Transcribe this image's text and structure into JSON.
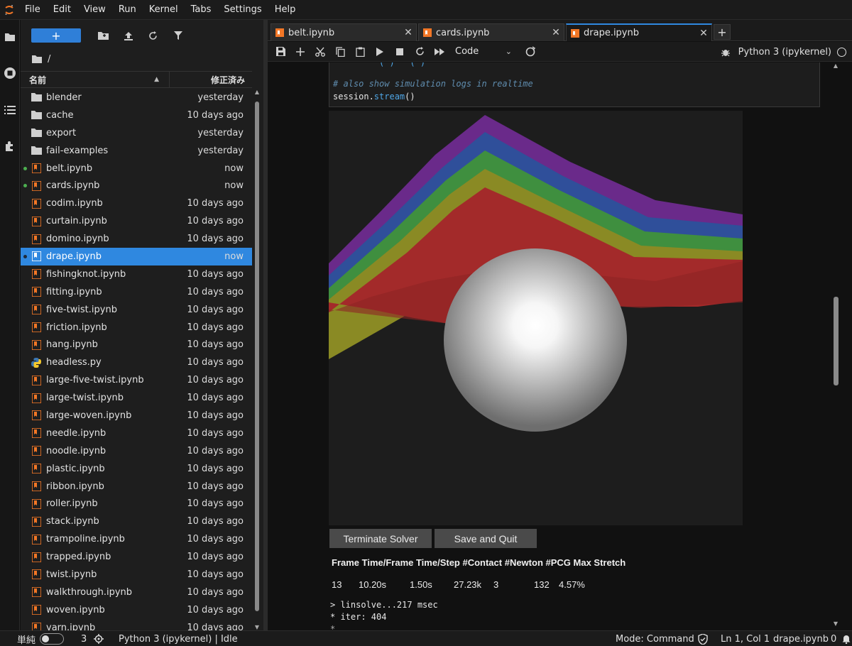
{
  "menubar": {
    "items": [
      "File",
      "Edit",
      "View",
      "Run",
      "Kernel",
      "Tabs",
      "Settings",
      "Help"
    ]
  },
  "filebrowser": {
    "new_label": "+",
    "path": "/",
    "header_name": "名前",
    "header_modified": "修正済み",
    "files": [
      {
        "name": "blender",
        "modified": "yesterday",
        "type": "folder",
        "dot": ""
      },
      {
        "name": "cache",
        "modified": "10 days ago",
        "type": "folder",
        "dot": ""
      },
      {
        "name": "export",
        "modified": "yesterday",
        "type": "folder",
        "dot": ""
      },
      {
        "name": "fail-examples",
        "modified": "yesterday",
        "type": "folder",
        "dot": ""
      },
      {
        "name": "belt.ipynb",
        "modified": "now",
        "type": "notebook",
        "dot": "green"
      },
      {
        "name": "cards.ipynb",
        "modified": "now",
        "type": "notebook",
        "dot": "green"
      },
      {
        "name": "codim.ipynb",
        "modified": "10 days ago",
        "type": "notebook",
        "dot": ""
      },
      {
        "name": "curtain.ipynb",
        "modified": "10 days ago",
        "type": "notebook",
        "dot": ""
      },
      {
        "name": "domino.ipynb",
        "modified": "10 days ago",
        "type": "notebook",
        "dot": ""
      },
      {
        "name": "drape.ipynb",
        "modified": "now",
        "type": "notebook",
        "dot": "dark",
        "selected": true
      },
      {
        "name": "fishingknot.ipynb",
        "modified": "10 days ago",
        "type": "notebook",
        "dot": ""
      },
      {
        "name": "fitting.ipynb",
        "modified": "10 days ago",
        "type": "notebook",
        "dot": ""
      },
      {
        "name": "five-twist.ipynb",
        "modified": "10 days ago",
        "type": "notebook",
        "dot": ""
      },
      {
        "name": "friction.ipynb",
        "modified": "10 days ago",
        "type": "notebook",
        "dot": ""
      },
      {
        "name": "hang.ipynb",
        "modified": "10 days ago",
        "type": "notebook",
        "dot": ""
      },
      {
        "name": "headless.py",
        "modified": "10 days ago",
        "type": "python",
        "dot": ""
      },
      {
        "name": "large-five-twist.ipynb",
        "modified": "10 days ago",
        "type": "notebook",
        "dot": ""
      },
      {
        "name": "large-twist.ipynb",
        "modified": "10 days ago",
        "type": "notebook",
        "dot": ""
      },
      {
        "name": "large-woven.ipynb",
        "modified": "10 days ago",
        "type": "notebook",
        "dot": ""
      },
      {
        "name": "needle.ipynb",
        "modified": "10 days ago",
        "type": "notebook",
        "dot": ""
      },
      {
        "name": "noodle.ipynb",
        "modified": "10 days ago",
        "type": "notebook",
        "dot": ""
      },
      {
        "name": "plastic.ipynb",
        "modified": "10 days ago",
        "type": "notebook",
        "dot": ""
      },
      {
        "name": "ribbon.ipynb",
        "modified": "10 days ago",
        "type": "notebook",
        "dot": ""
      },
      {
        "name": "roller.ipynb",
        "modified": "10 days ago",
        "type": "notebook",
        "dot": ""
      },
      {
        "name": "stack.ipynb",
        "modified": "10 days ago",
        "type": "notebook",
        "dot": ""
      },
      {
        "name": "trampoline.ipynb",
        "modified": "10 days ago",
        "type": "notebook",
        "dot": ""
      },
      {
        "name": "trapped.ipynb",
        "modified": "10 days ago",
        "type": "notebook",
        "dot": ""
      },
      {
        "name": "twist.ipynb",
        "modified": "10 days ago",
        "type": "notebook",
        "dot": ""
      },
      {
        "name": "walkthrough.ipynb",
        "modified": "10 days ago",
        "type": "notebook",
        "dot": ""
      },
      {
        "name": "woven.ipynb",
        "modified": "10 days ago",
        "type": "notebook",
        "dot": ""
      },
      {
        "name": "yarn.ipynb",
        "modified": "10 days ago",
        "type": "notebook",
        "dot": ""
      }
    ]
  },
  "tabs": [
    {
      "label": "belt.ipynb",
      "active": false
    },
    {
      "label": "cards.ipynb",
      "active": false
    },
    {
      "label": "drape.ipynb",
      "active": true
    }
  ],
  "toolbar": {
    "cell_type": "Code",
    "kernel_name": "Python 3 (ipykernel)"
  },
  "cell": {
    "comment": "# also show simulation logs in realtime",
    "code_obj": "session.",
    "code_fn": "stream",
    "code_end": "()"
  },
  "widget": {
    "terminate_label": "Terminate Solver",
    "save_label": "Save and Quit",
    "stats_header": "Frame Time/Frame Time/Step #Contact #Newton #PCG Max Stretch",
    "stats_values": [
      "13",
      "10.20s",
      "1.50s",
      "27.23k",
      "3",
      "132",
      "4.57%"
    ],
    "logs": [
      "> linsolve...217 msec",
      "* iter: 404"
    ]
  },
  "statusbar": {
    "simple_label": "単純",
    "terminal_count": "3",
    "kernel_status": "Python 3 (ipykernel) | Idle",
    "mode": "Mode: Command",
    "cursor": "Ln 1, Col 1",
    "filename": "drape.ipynb",
    "notifications": "0"
  },
  "colors": {
    "accent": "#2f88e0",
    "notebook_icon": "#f37726",
    "running_dot": "#4caf50",
    "cloth_layers": [
      "#6a2a8a",
      "#2f4f9a",
      "#3f8f3f",
      "#8a8a24",
      "#a32a2a"
    ]
  }
}
